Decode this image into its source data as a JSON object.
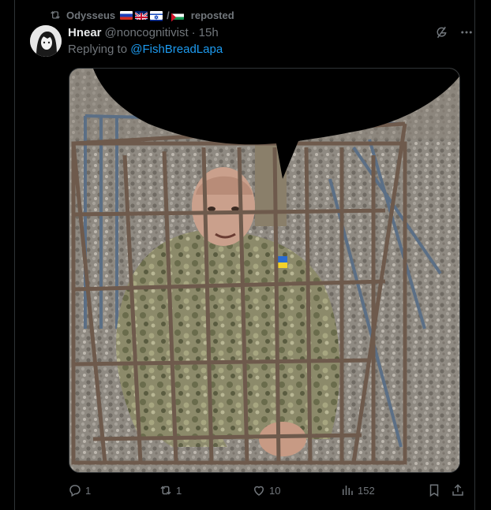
{
  "repost": {
    "user": "Odysseus",
    "flags": [
      "russia-flag",
      "uk-flag",
      "israel-flag",
      "palestine-flag"
    ],
    "flag_separator": "/",
    "label": "reposted"
  },
  "tweet": {
    "display_name": "Hnear",
    "handle": "@noncognitivist",
    "separator": "·",
    "time": "15h",
    "reply_prefix": "Replying to",
    "reply_to": "@FishBreadLapa"
  },
  "actions": {
    "replies": "1",
    "reposts": "1",
    "likes": "10",
    "views": "152"
  },
  "colors": {
    "background": "#000000",
    "text": "#e7e9ea",
    "muted": "#71767b",
    "link": "#1d9bf0",
    "border": "#2f3336"
  },
  "icons": [
    "repost-icon",
    "grok-icon",
    "more-icon",
    "reply-icon",
    "retweet-icon",
    "like-icon",
    "views-icon",
    "bookmark-icon",
    "share-icon"
  ]
}
